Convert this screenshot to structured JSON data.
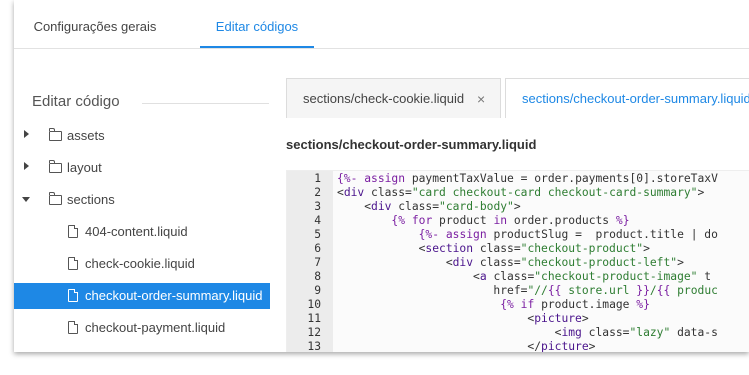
{
  "top_tabs": [
    "Configurações gerais",
    "Editar códigos"
  ],
  "sidebar": {
    "title": "Editar código",
    "items": [
      {
        "label": "assets",
        "type": "folder",
        "caret": "right",
        "indent": 0
      },
      {
        "label": "layout",
        "type": "folder",
        "caret": "right",
        "indent": 0
      },
      {
        "label": "sections",
        "type": "folder",
        "caret": "down",
        "indent": 0
      },
      {
        "label": "404-content.liquid",
        "type": "file",
        "indent": 1
      },
      {
        "label": "check-cookie.liquid",
        "type": "file",
        "indent": 1
      },
      {
        "label": "checkout-order-summary.liquid",
        "type": "file",
        "indent": 1,
        "selected": true
      },
      {
        "label": "checkout-payment.liquid",
        "type": "file",
        "indent": 1
      }
    ]
  },
  "editor": {
    "tabs": [
      {
        "label": "sections/check-cookie.liquid",
        "close": "×"
      },
      {
        "label": "sections/checkout-order-summary.liquid"
      }
    ],
    "file_heading": "sections/checkout-order-summary.liquid",
    "lines": [
      {
        "n": "1",
        "text": "{%- assign paymentTaxValue = order.payments[0].storeTaxV"
      },
      {
        "n": "2",
        "text": "<div class=\"card checkout-card checkout-card-summary\">"
      },
      {
        "n": "3",
        "text": "    <div class=\"card-body\">"
      },
      {
        "n": "4",
        "text": "        {% for product in order.products %}"
      },
      {
        "n": "5",
        "text": "            {%- assign productSlug =  product.title | do"
      },
      {
        "n": "6",
        "text": "            <section class=\"checkout-product\">"
      },
      {
        "n": "7",
        "text": "                <div class=\"checkout-product-left\">"
      },
      {
        "n": "8",
        "text": "                    <a class=\"checkout-product-image\" t"
      },
      {
        "n": "9",
        "text": "                       href=\"//{{ store.url }}/{{ produc"
      },
      {
        "n": "10",
        "text": "                        {% if product.image %}"
      },
      {
        "n": "11",
        "text": "                            <picture>"
      },
      {
        "n": "12",
        "text": "                                <img class=\"lazy\" data-s"
      },
      {
        "n": "13",
        "text": "                            </picture>"
      }
    ]
  },
  "colors": {
    "accent": "#1e88e5"
  }
}
